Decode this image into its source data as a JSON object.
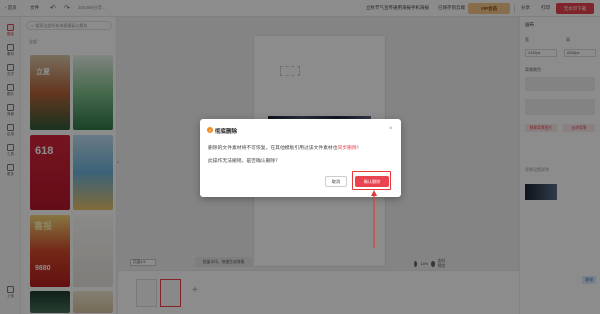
{
  "topbar": {
    "back_label": "‹ 首页",
    "file_label": "文件",
    "doc_title": "305486分享...",
    "center_text": "立秋节气宣传通用海报手机海报",
    "share_save": "云端",
    "save_label": "已保存到云端",
    "vip_label": "VIP会员",
    "share_label": "分享",
    "print_label": "打印",
    "download_label": "无水印下载"
  },
  "rail": {
    "items": [
      "模板",
      "素材",
      "文字",
      "图片",
      "背景",
      "应用",
      "工具",
      "更多",
      "上传"
    ]
  },
  "panel": {
    "search_placeholder": "搜索全部所有海报模板以素材",
    "tabs": [
      "全部"
    ],
    "thumbs": [
      {
        "text": "立夏"
      },
      {
        "text": ""
      },
      {
        "text": "618"
      },
      {
        "text": ""
      },
      {
        "text": "喜报"
      },
      {
        "text": ""
      },
      {
        "text": "9880"
      },
      {
        "text": ""
      }
    ]
  },
  "canvas": {
    "page_select": "页面1/1",
    "bulk_label": "批量水印，快速生成海报",
    "zoom_level": "15%",
    "zoom_icons": [
      "zoom-out-icon",
      "zoom-in-icon"
    ],
    "preview_label": "实时预览"
  },
  "right_panel": {
    "title": "画布",
    "width_label": "宽",
    "width_value": "1242px",
    "height_label": "高",
    "height_value": "2208px",
    "bg_label": "背景颜色",
    "btn_left": "替换背景图片",
    "btn_right": "去除背景",
    "note": "背景设置说明",
    "side_tab": "客服"
  },
  "dialog": {
    "title": "彻底删除",
    "line1_before": "删除的文件素材将不可恢复，在其他模板引用过该文件素材也",
    "line1_highlight": "同步删除",
    "line1_after": "！",
    "line2": "此操作无法撤销，是否确认删除？",
    "cancel_label": "取消",
    "confirm_label": "确认删除"
  },
  "colors": {
    "accent": "#e8434f",
    "vip": "#f7c68a",
    "overlay": "rgba(0,0,0,0.45)",
    "annotation": "#e53939"
  }
}
